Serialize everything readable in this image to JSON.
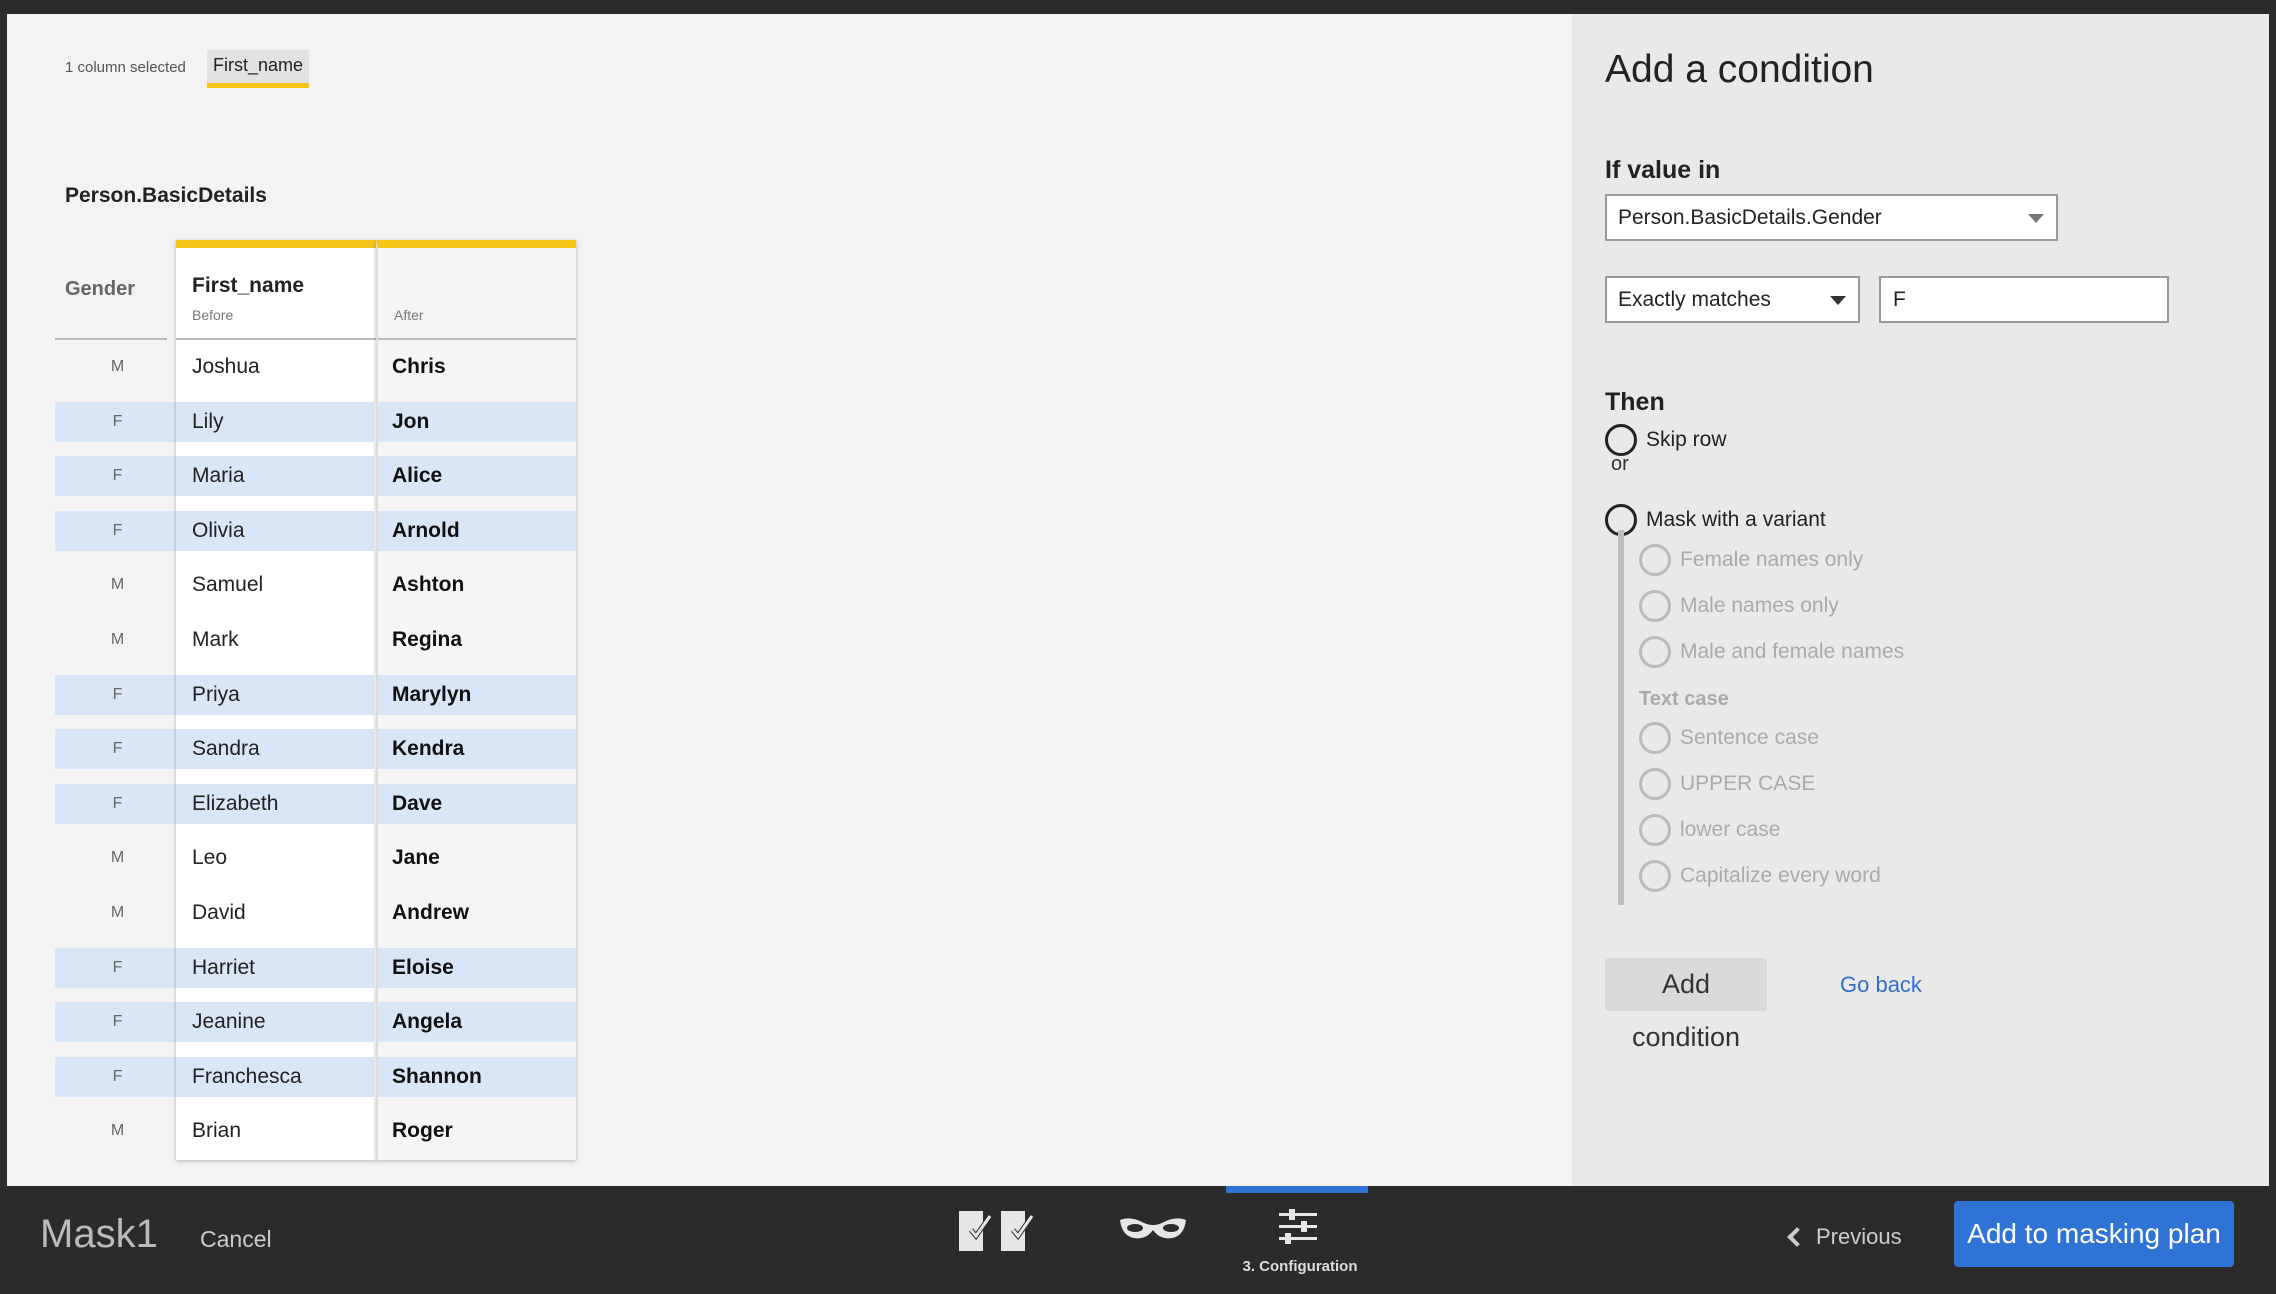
{
  "selection": {
    "info": "1 column selected",
    "column_chip": "First_name"
  },
  "table": {
    "title": "Person.BasicDetails",
    "gender_header": "Gender",
    "before_header": {
      "title": "First_name",
      "sub": "Before"
    },
    "after_header": {
      "title": "",
      "sub": "After"
    },
    "rows": [
      {
        "gender": "M",
        "before": "Joshua",
        "after": "Chris",
        "highlight": false
      },
      {
        "gender": "F",
        "before": "Lily",
        "after": "Jon",
        "highlight": true
      },
      {
        "gender": "F",
        "before": "Maria",
        "after": "Alice",
        "highlight": true
      },
      {
        "gender": "F",
        "before": "Olivia",
        "after": "Arnold",
        "highlight": true
      },
      {
        "gender": "M",
        "before": "Samuel",
        "after": "Ashton",
        "highlight": false
      },
      {
        "gender": "M",
        "before": "Mark",
        "after": "Regina",
        "highlight": false
      },
      {
        "gender": "F",
        "before": "Priya",
        "after": "Marylyn",
        "highlight": true
      },
      {
        "gender": "F",
        "before": "Sandra",
        "after": "Kendra",
        "highlight": true
      },
      {
        "gender": "F",
        "before": "Elizabeth",
        "after": "Dave",
        "highlight": true
      },
      {
        "gender": "M",
        "before": "Leo",
        "after": "Jane",
        "highlight": false
      },
      {
        "gender": "M",
        "before": "David",
        "after": "Andrew",
        "highlight": false
      },
      {
        "gender": "F",
        "before": "Harriet",
        "after": "Eloise",
        "highlight": true
      },
      {
        "gender": "F",
        "before": "Jeanine",
        "after": "Angela",
        "highlight": true
      },
      {
        "gender": "F",
        "before": "Franchesca",
        "after": "Shannon",
        "highlight": true
      },
      {
        "gender": "M",
        "before": "Brian",
        "after": "Roger",
        "highlight": false
      }
    ]
  },
  "condition": {
    "title": "Add a condition",
    "if_label": "If value in",
    "field_value": "Person.BasicDetails.Gender",
    "operator_value": "Exactly matches",
    "match_value": "F",
    "then_label": "Then",
    "skip_row": "Skip row",
    "or_text": "or",
    "mask_variant": "Mask with a variant",
    "variant_options": [
      "Female names only",
      "Male names only",
      "Male and female names"
    ],
    "text_case_label": "Text case",
    "text_case_options": [
      "Sentence case",
      "UPPER CASE",
      "lower case",
      "Capitalize every word"
    ],
    "add_button": "Add condition",
    "back_link": "Go back"
  },
  "footer": {
    "mask_name": "Mask1",
    "cancel": "Cancel",
    "step_label": "3. Configuration",
    "previous": "Previous",
    "primary": "Add to masking plan"
  },
  "colors": {
    "accent_yellow": "#f5c518",
    "row_highlight": "#d9e6f7",
    "primary_blue": "#2f74d5"
  }
}
